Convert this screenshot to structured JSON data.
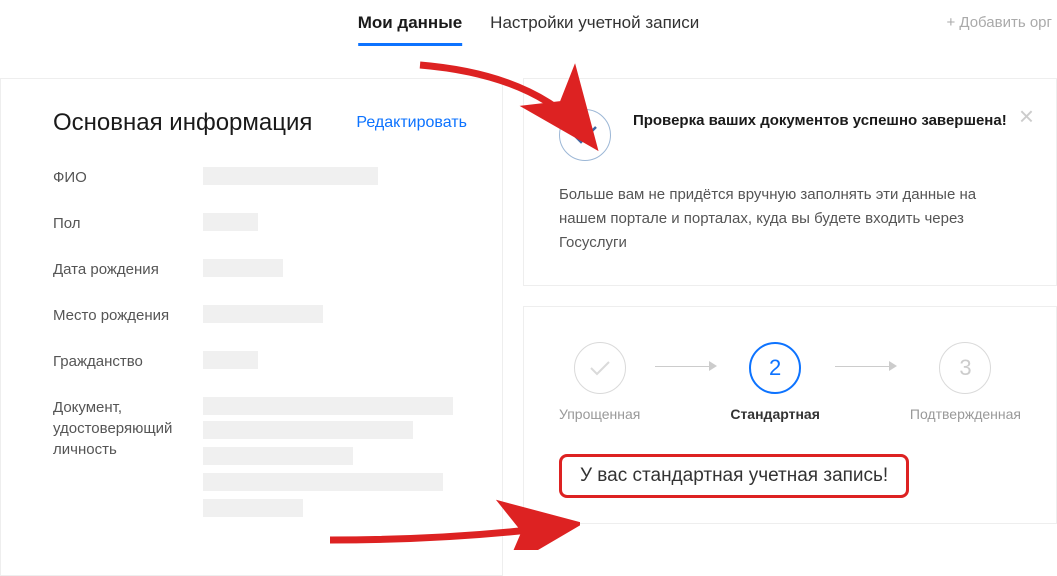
{
  "tabs": {
    "my_data": "Мои данные",
    "settings": "Настройки учетной записи",
    "add_org": "+ Добавить орг"
  },
  "basic_info": {
    "title": "Основная информация",
    "edit": "Редактировать",
    "labels": {
      "fio": "ФИО",
      "gender": "Пол",
      "birth_date": "Дата рождения",
      "birth_place": "Место рождения",
      "citizenship": "Гражданство",
      "id_doc": "Документ, удостоверяющий личность"
    }
  },
  "success": {
    "title": "Проверка ваших документов успешно завершена!",
    "desc": "Больше вам не придётся вручную заполнять эти данные на нашем портале и порталах, куда вы будете входить через Госуслуги"
  },
  "steps": {
    "s1_label": "Упрощенная",
    "s2_num": "2",
    "s2_label": "Стандартная",
    "s3_num": "3",
    "s3_label": "Подтвержденная"
  },
  "status_text": "У вас стандартная учетная запись!"
}
